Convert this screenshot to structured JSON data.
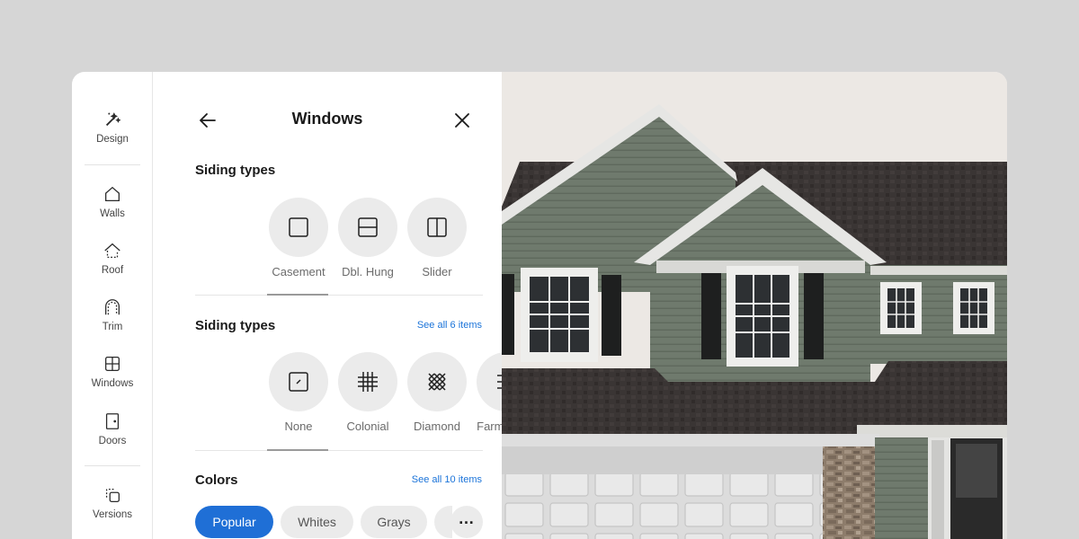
{
  "rail": {
    "items": [
      {
        "label": "Design",
        "icon": "magic-wand-icon"
      },
      {
        "label": "Walls",
        "icon": "house-outline-icon"
      },
      {
        "label": "Roof",
        "icon": "roof-outline-icon"
      },
      {
        "label": "Trim",
        "icon": "arch-trim-icon"
      },
      {
        "label": "Windows",
        "icon": "window-grid-icon"
      },
      {
        "label": "Doors",
        "icon": "door-icon"
      },
      {
        "label": "Versions",
        "icon": "versions-stack-icon"
      }
    ]
  },
  "panel": {
    "title": "Windows",
    "section1": {
      "title": "Siding types",
      "options": [
        {
          "label": "Casement",
          "icon": "casement-window-icon"
        },
        {
          "label": "Dbl. Hung",
          "icon": "double-hung-window-icon"
        },
        {
          "label": "Slider",
          "icon": "slider-window-icon"
        }
      ],
      "selected": "Casement"
    },
    "section2": {
      "title": "Siding types",
      "see_all": "See all 6 items",
      "options": [
        {
          "label": "None",
          "icon": "no-grid-icon"
        },
        {
          "label": "Colonial",
          "icon": "colonial-grid-icon"
        },
        {
          "label": "Diamond",
          "icon": "diamond-grid-icon"
        },
        {
          "label": "Farmhouse",
          "icon": "farmhouse-grid-icon"
        }
      ],
      "selected": "None"
    },
    "section3": {
      "title": "Colors",
      "see_all": "See all 10 items",
      "chips": [
        "Popular",
        "Whites",
        "Grays"
      ],
      "active_chip": "Popular"
    }
  },
  "colors": {
    "accent": "#1f6fd6",
    "link": "#1a73d9",
    "siding": "#6f7a6d",
    "roof": "#3a3534",
    "trim": "#e4e4e2",
    "shutter": "#1e1f1f"
  }
}
